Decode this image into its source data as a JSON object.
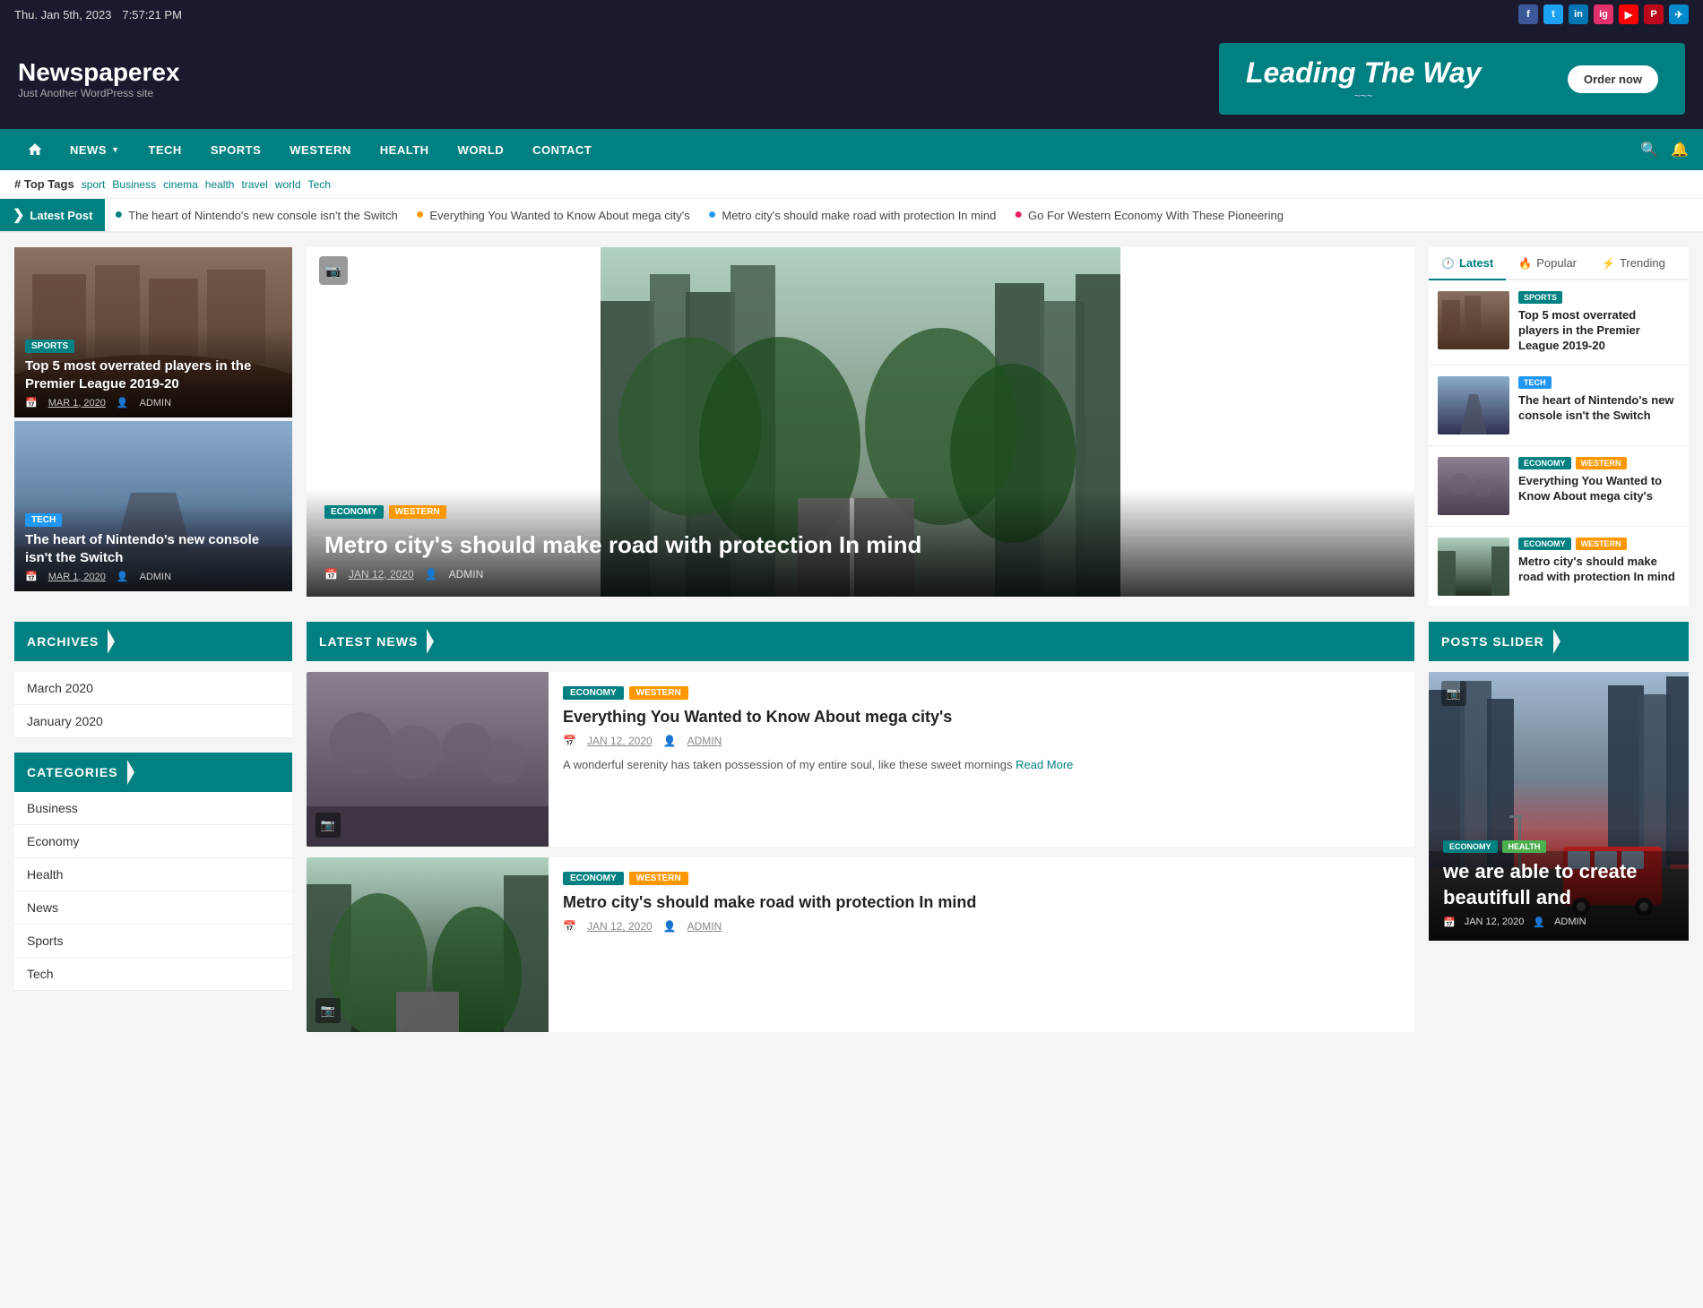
{
  "topbar": {
    "date": "Thu. Jan 5th, 2023",
    "time": "7:57:21 PM",
    "socials": [
      {
        "name": "facebook",
        "label": "f",
        "class": "si-fb"
      },
      {
        "name": "twitter",
        "label": "t",
        "class": "si-tw"
      },
      {
        "name": "linkedin",
        "label": "in",
        "class": "si-li"
      },
      {
        "name": "instagram",
        "label": "ig",
        "class": "si-ig"
      },
      {
        "name": "youtube",
        "label": "▶",
        "class": "si-yt"
      },
      {
        "name": "pinterest",
        "label": "p",
        "class": "si-pi"
      },
      {
        "name": "telegram",
        "label": "✈",
        "class": "si-tg"
      }
    ]
  },
  "header": {
    "logo": "Newspaperex",
    "tagline": "Just Another WordPress site",
    "banner_text": "Leading The Way",
    "banner_sub": "~~~",
    "order_btn": "Order now"
  },
  "nav": {
    "home_label": "home",
    "items": [
      {
        "label": "NEWS",
        "has_arrow": true
      },
      {
        "label": "TECH",
        "has_arrow": false
      },
      {
        "label": "SPORTS",
        "has_arrow": false
      },
      {
        "label": "WESTERN",
        "has_arrow": false
      },
      {
        "label": "HEALTH",
        "has_arrow": false
      },
      {
        "label": "WORLD",
        "has_arrow": false
      },
      {
        "label": "CONTACT",
        "has_arrow": false
      }
    ]
  },
  "toptags": {
    "label": "# Top Tags",
    "tags": [
      "sport",
      "Business",
      "cinema",
      "health",
      "travel",
      "world",
      "Tech"
    ]
  },
  "ticker": {
    "label": "Latest Post",
    "items": [
      "The heart of Nintendo's new console isn't the Switch",
      "Everything You Wanted to Know About mega city's",
      "Metro city's should make road with protection In mind",
      "Go For Western Economy With These Pioneering"
    ]
  },
  "left_cards": [
    {
      "category": "SPORTS",
      "category_class": "sports",
      "title": "Top 5 most overrated players in the Premier League 2019-20",
      "date": "MAR 1, 2020",
      "author": "ADMIN",
      "img_class": "img-library"
    },
    {
      "category": "TECH",
      "category_class": "tech",
      "title": "The heart of Nintendo's new console isn't the Switch",
      "date": "MAR 1, 2020",
      "author": "ADMIN",
      "img_class": "img-road"
    }
  ],
  "center_feature": {
    "categories": [
      "ECONOMY",
      "WESTERN"
    ],
    "title": "Metro city's should make road with protection In mind",
    "date": "JAN 12, 2020",
    "author": "ADMIN",
    "img_class": "img-city"
  },
  "right_tabs": {
    "tabs": [
      {
        "label": "Latest",
        "icon": "🕐",
        "active": true
      },
      {
        "label": "Popular",
        "icon": "🔥"
      },
      {
        "label": "Trending",
        "icon": "⚡"
      }
    ],
    "cards": [
      {
        "categories": [
          {
            "label": "SPORTS",
            "class": ""
          }
        ],
        "title": "Top 5 most overrated players in the Premier League 2019-20",
        "img_class": "img-library"
      },
      {
        "categories": [
          {
            "label": "TECH",
            "class": "tech"
          }
        ],
        "title": "The heart of Nintendo's new console isn't the Switch",
        "img_class": "img-road"
      },
      {
        "categories": [
          {
            "label": "ECONOMY",
            "class": ""
          },
          {
            "label": "WESTERN",
            "class": "western"
          }
        ],
        "title": "Everything You Wanted to Know About mega city's",
        "img_class": "img-crowd"
      },
      {
        "categories": [
          {
            "label": "ECONOMY",
            "class": ""
          },
          {
            "label": "WESTERN",
            "class": "western"
          }
        ],
        "title": "Metro city's should make road with protection In mind",
        "img_class": "img-city"
      }
    ]
  },
  "archives": {
    "header": "Archives",
    "items": [
      "March 2020",
      "January 2020"
    ]
  },
  "categories": {
    "header": "Categories",
    "items": [
      "Business",
      "Economy",
      "Health",
      "News",
      "Sports",
      "Tech"
    ]
  },
  "latest_news": {
    "header": "LATEST NEWS",
    "cards": [
      {
        "categories": [
          {
            "label": "ECONOMY",
            "class": ""
          },
          {
            "label": "WESTERN",
            "class": "western"
          }
        ],
        "title": "Everything You Wanted to Know About mega city's",
        "date": "JAN 12, 2020",
        "author": "ADMIN",
        "excerpt": "A wonderful serenity has taken possession of my entire soul, like these sweet mornings",
        "read_more": "Read More",
        "img_class": "img-crowd"
      },
      {
        "categories": [
          {
            "label": "ECONOMY",
            "class": ""
          },
          {
            "label": "WESTERN",
            "class": "western"
          }
        ],
        "title": "Metro city's should make road with protection In mind",
        "date": "JAN 12, 2020",
        "author": "ADMIN",
        "excerpt": "",
        "read_more": "",
        "img_class": "img-city"
      }
    ]
  },
  "posts_slider": {
    "header": "POSTS SLIDER",
    "card": {
      "categories": [
        {
          "label": "ECONOMY",
          "class": ""
        },
        {
          "label": "HEALTH",
          "class": "health"
        }
      ],
      "title": "we are able to create beautifull and",
      "date": "JAN 12, 2020",
      "author": "ADMIN",
      "img_class": "img-bus"
    }
  },
  "sidebar_categories": {
    "health_label": "Health",
    "news_label": "News"
  }
}
